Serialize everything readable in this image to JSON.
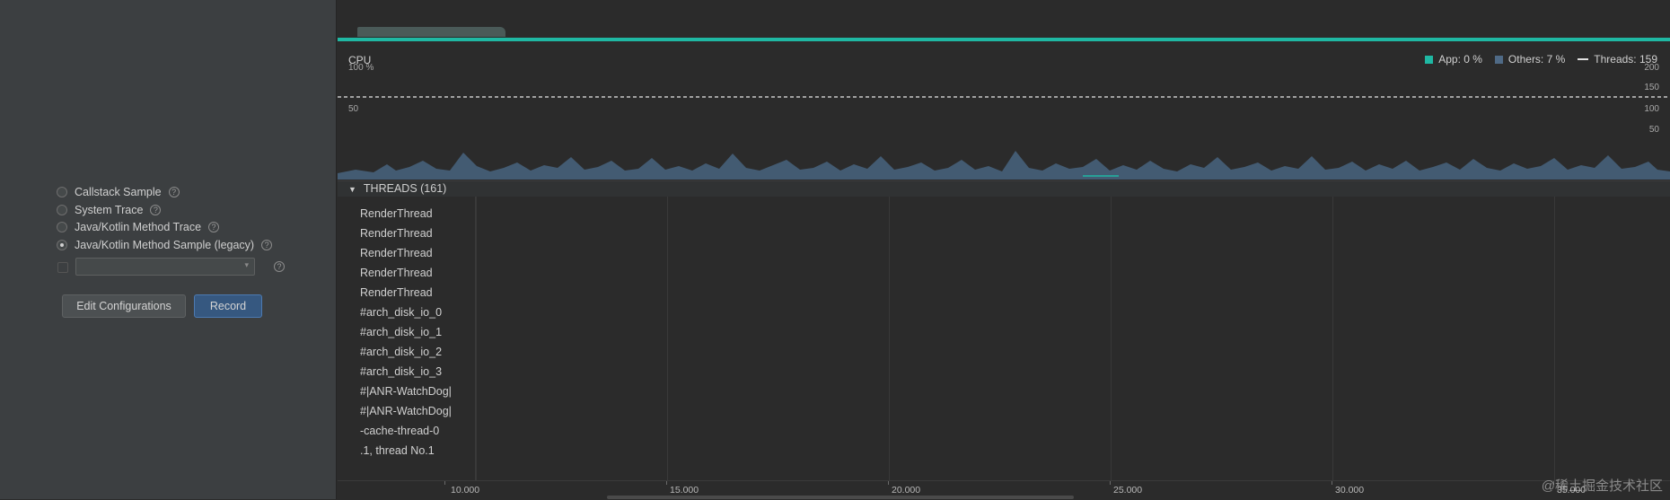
{
  "config_panel": {
    "options": [
      {
        "label": "Callstack Sample",
        "checked": false
      },
      {
        "label": "System Trace",
        "checked": false
      },
      {
        "label": "Java/Kotlin Method Trace",
        "checked": false
      },
      {
        "label": "Java/Kotlin Method Sample (legacy)",
        "checked": true
      }
    ],
    "help_glyph": "?",
    "combo_arrow": "▾",
    "edit_configurations_label": "Edit Configurations",
    "record_label": "Record"
  },
  "cpu": {
    "title": "CPU",
    "axis_left": {
      "top": "100 %",
      "mid": "50"
    },
    "axis_right": {
      "t200": "200",
      "t150": "150",
      "t100": "100",
      "t50": "50"
    },
    "legend": {
      "app": "App: 0 %",
      "others": "Others: 7 %",
      "threads": "Threads: 159"
    },
    "colors": {
      "app": "#1fb8a3",
      "others": "#4f6a86",
      "threads": "#e0e0e0"
    }
  },
  "threads": {
    "header": "THREADS (161)",
    "arrow": "▼",
    "names": [
      "RenderThread",
      "RenderThread",
      "RenderThread",
      "RenderThread",
      "RenderThread",
      "#arch_disk_io_0",
      "#arch_disk_io_1",
      "#arch_disk_io_2",
      "#arch_disk_io_3",
      "#|ANR-WatchDog|",
      "#|ANR-WatchDog|",
      "-cache-thread-0",
      ".1, thread No.1"
    ]
  },
  "time_axis": {
    "labels": [
      "10.000",
      "15.000",
      "20.000",
      "25.000",
      "30.000",
      "35.000"
    ]
  },
  "watermark": "@稀土掘金技术社区"
}
